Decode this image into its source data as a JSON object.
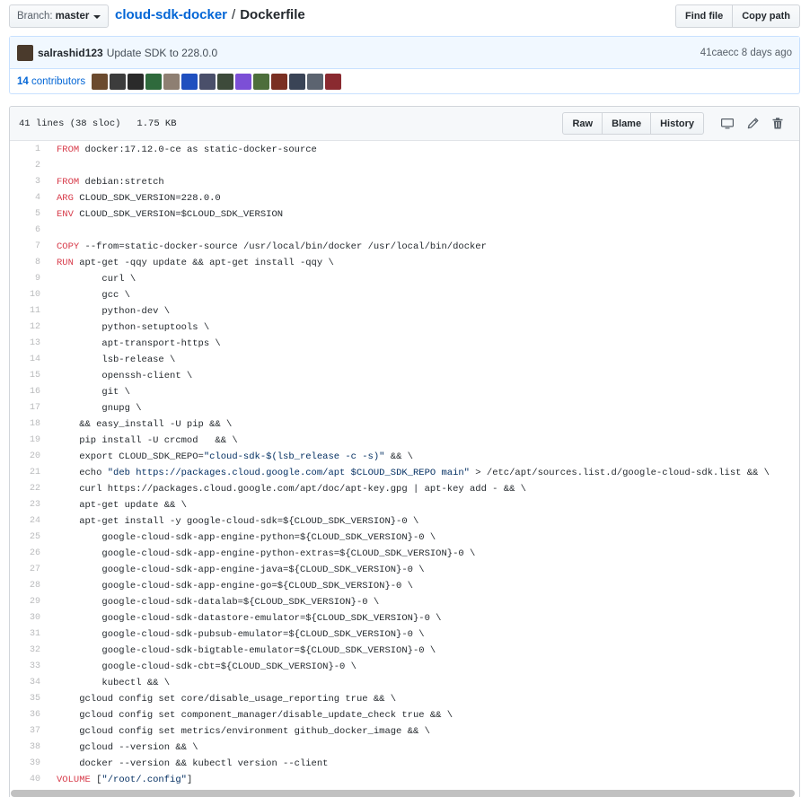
{
  "branch": {
    "prefix": "Branch:",
    "name": "master"
  },
  "breadcrumb": {
    "repo": "cloud-sdk-docker",
    "separator": "/",
    "file": "Dockerfile"
  },
  "file_nav": {
    "find_file": "Find file",
    "copy_path": "Copy path"
  },
  "commit": {
    "author": "salrashid123",
    "message": "Update SDK to 228.0.0",
    "sha": "41caecc",
    "time": "8 days ago",
    "contributors_count": "14",
    "contributors_label": "contributors",
    "contributor_colors": [
      "#6b4a2e",
      "#3c3c3c",
      "#2a2a2a",
      "#2f6a3c",
      "#8e7f72",
      "#1f4fbf",
      "#4a4f6a",
      "#3d4a3a",
      "#7c4fd6",
      "#4d6e3b",
      "#7a2f22",
      "#3a4456",
      "#5c6470",
      "#8a2a30"
    ]
  },
  "file_header": {
    "lines": "41 lines (38 sloc)",
    "size": "1.75 KB"
  },
  "file_actions": {
    "raw": "Raw",
    "blame": "Blame",
    "history": "History"
  },
  "code_lines": [
    {
      "num": "1",
      "kw": "FROM",
      "text": " docker:17.12.0-ce as static-docker-source"
    },
    {
      "num": "2",
      "kw": "",
      "text": ""
    },
    {
      "num": "3",
      "kw": "FROM",
      "text": " debian:stretch"
    },
    {
      "num": "4",
      "kw": "ARG",
      "text": " CLOUD_SDK_VERSION=228.0.0"
    },
    {
      "num": "5",
      "kw": "ENV",
      "text": " CLOUD_SDK_VERSION=$CLOUD_SDK_VERSION"
    },
    {
      "num": "6",
      "kw": "",
      "text": ""
    },
    {
      "num": "7",
      "kw": "COPY",
      "text": " --from=static-docker-source /usr/local/bin/docker /usr/local/bin/docker"
    },
    {
      "num": "8",
      "kw": "RUN",
      "text": " apt-get -qqy update && apt-get install -qqy \\"
    },
    {
      "num": "9",
      "kw": "",
      "text": "        curl \\"
    },
    {
      "num": "10",
      "kw": "",
      "text": "        gcc \\"
    },
    {
      "num": "11",
      "kw": "",
      "text": "        python-dev \\"
    },
    {
      "num": "12",
      "kw": "",
      "text": "        python-setuptools \\"
    },
    {
      "num": "13",
      "kw": "",
      "text": "        apt-transport-https \\"
    },
    {
      "num": "14",
      "kw": "",
      "text": "        lsb-release \\"
    },
    {
      "num": "15",
      "kw": "",
      "text": "        openssh-client \\"
    },
    {
      "num": "16",
      "kw": "",
      "text": "        git \\"
    },
    {
      "num": "17",
      "kw": "",
      "text": "        gnupg \\"
    },
    {
      "num": "18",
      "kw": "",
      "text": "    && easy_install -U pip && \\"
    },
    {
      "num": "19",
      "kw": "",
      "text": "    pip install -U crcmod   && \\"
    },
    {
      "num": "20",
      "kw": "",
      "text": "    export CLOUD_SDK_REPO=",
      "str": "\"cloud-sdk-$(lsb_release -c -s)\"",
      "tail": " && \\"
    },
    {
      "num": "21",
      "kw": "",
      "text": "    echo ",
      "str": "\"deb https://packages.cloud.google.com/apt $CLOUD_SDK_REPO main\"",
      "tail": " > /etc/apt/sources.list.d/google-cloud-sdk.list && \\"
    },
    {
      "num": "22",
      "kw": "",
      "text": "    curl https://packages.cloud.google.com/apt/doc/apt-key.gpg | apt-key add - && \\"
    },
    {
      "num": "23",
      "kw": "",
      "text": "    apt-get update && \\"
    },
    {
      "num": "24",
      "kw": "",
      "text": "    apt-get install -y google-cloud-sdk=${CLOUD_SDK_VERSION}-0 \\"
    },
    {
      "num": "25",
      "kw": "",
      "text": "        google-cloud-sdk-app-engine-python=${CLOUD_SDK_VERSION}-0 \\"
    },
    {
      "num": "26",
      "kw": "",
      "text": "        google-cloud-sdk-app-engine-python-extras=${CLOUD_SDK_VERSION}-0 \\"
    },
    {
      "num": "27",
      "kw": "",
      "text": "        google-cloud-sdk-app-engine-java=${CLOUD_SDK_VERSION}-0 \\"
    },
    {
      "num": "28",
      "kw": "",
      "text": "        google-cloud-sdk-app-engine-go=${CLOUD_SDK_VERSION}-0 \\"
    },
    {
      "num": "29",
      "kw": "",
      "text": "        google-cloud-sdk-datalab=${CLOUD_SDK_VERSION}-0 \\"
    },
    {
      "num": "30",
      "kw": "",
      "text": "        google-cloud-sdk-datastore-emulator=${CLOUD_SDK_VERSION}-0 \\"
    },
    {
      "num": "31",
      "kw": "",
      "text": "        google-cloud-sdk-pubsub-emulator=${CLOUD_SDK_VERSION}-0 \\"
    },
    {
      "num": "32",
      "kw": "",
      "text": "        google-cloud-sdk-bigtable-emulator=${CLOUD_SDK_VERSION}-0 \\"
    },
    {
      "num": "33",
      "kw": "",
      "text": "        google-cloud-sdk-cbt=${CLOUD_SDK_VERSION}-0 \\"
    },
    {
      "num": "34",
      "kw": "",
      "text": "        kubectl && \\"
    },
    {
      "num": "35",
      "kw": "",
      "text": "    gcloud config set core/disable_usage_reporting true && \\"
    },
    {
      "num": "36",
      "kw": "",
      "text": "    gcloud config set component_manager/disable_update_check true && \\"
    },
    {
      "num": "37",
      "kw": "",
      "text": "    gcloud config set metrics/environment github_docker_image && \\"
    },
    {
      "num": "38",
      "kw": "",
      "text": "    gcloud --version && \\"
    },
    {
      "num": "39",
      "kw": "",
      "text": "    docker --version && kubectl version --client"
    },
    {
      "num": "40",
      "kw": "VOLUME",
      "text": " [",
      "str": "\"/root/.config\"",
      "tail": "]"
    }
  ]
}
